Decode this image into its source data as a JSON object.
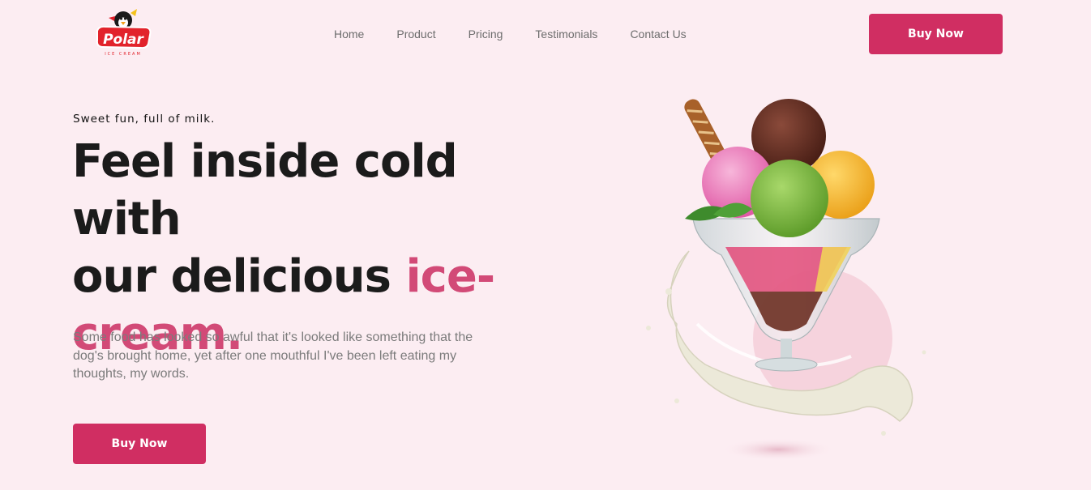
{
  "brand": {
    "logo_text": "Polar",
    "logo_subtext": "ICE CREAM",
    "colors": {
      "accent": "#d02e62",
      "accent_text": "#d24a77",
      "background": "#fcedf2"
    }
  },
  "nav": {
    "items": [
      {
        "label": "Home"
      },
      {
        "label": "Product"
      },
      {
        "label": "Pricing"
      },
      {
        "label": "Testimonials"
      },
      {
        "label": "Contact Us"
      }
    ]
  },
  "header": {
    "cta_label": "Buy Now"
  },
  "hero": {
    "tagline": "Sweet fun, full of milk.",
    "headline_line1": "Feel inside cold with",
    "headline_line2": "our delicious ",
    "headline_accent1": "ice-",
    "headline_accent2": "cream.",
    "description": "Some food has looked so awful that it's looked like something that the dog's brought home, yet after one mouthful I've been left eating my thoughts, my words.",
    "cta_label": "Buy Now",
    "image": "ice-cream-sundae-illustration"
  }
}
